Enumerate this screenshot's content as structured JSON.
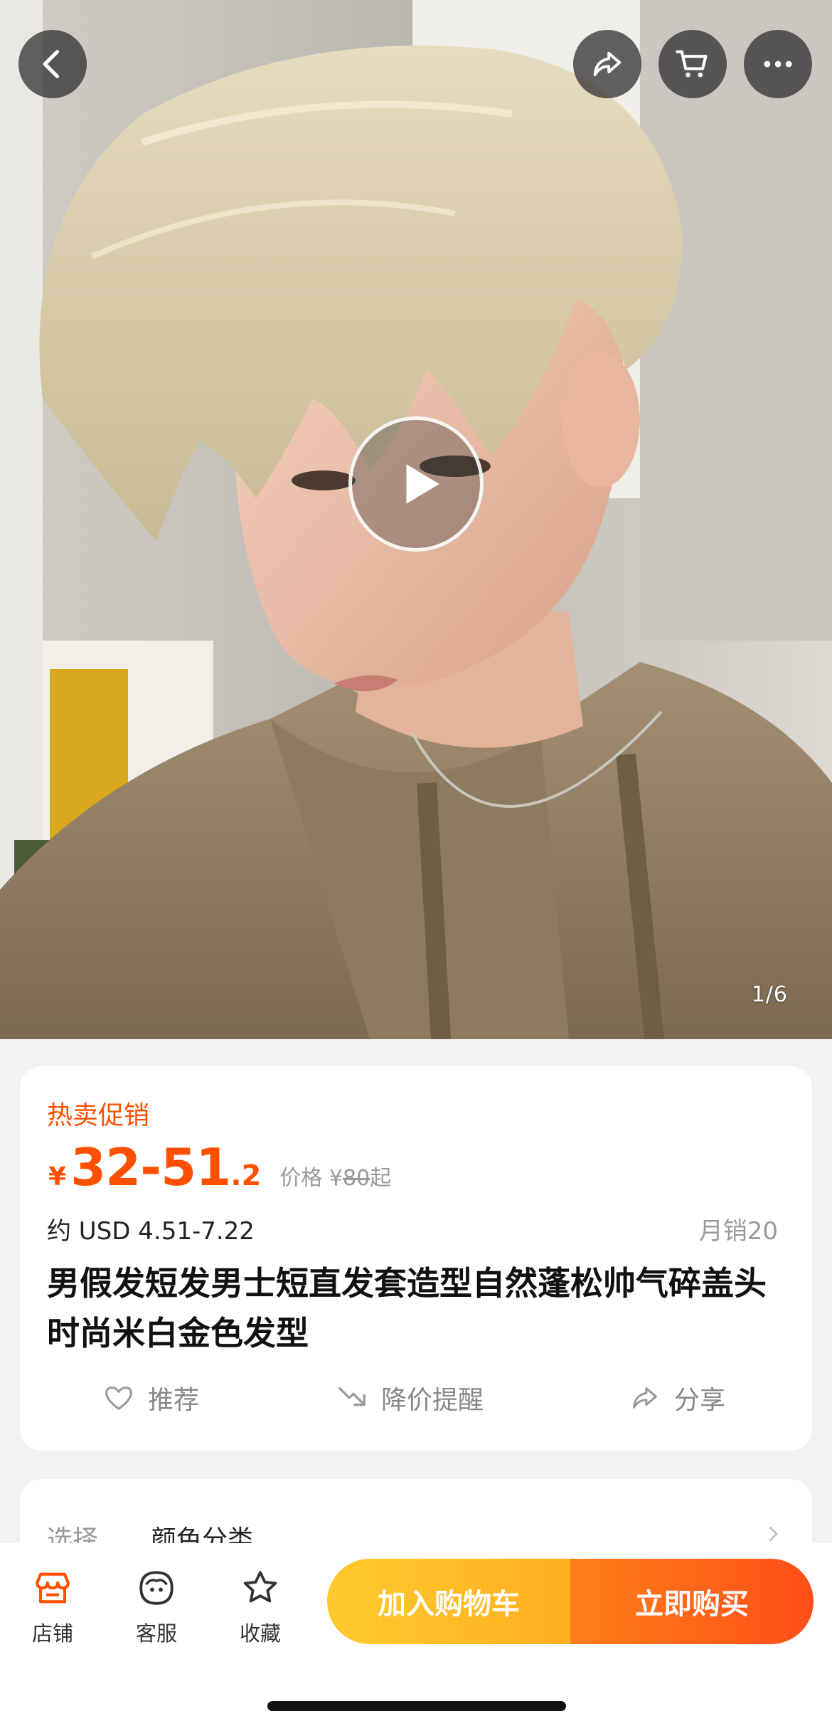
{
  "hero": {
    "page_indicator": "1/6",
    "image_subject": "product-photo-blonde-wig"
  },
  "top_nav": {
    "back_icon": "chevron-left-icon",
    "share_icon": "share-icon",
    "cart_icon": "cart-icon",
    "more_icon": "more-icon"
  },
  "price_card": {
    "promo_tag": "热卖促销",
    "currency": "¥",
    "price_main": "32-51",
    "price_decimal": ".2",
    "orig_price_label": "价格 ¥",
    "orig_price_value": "80",
    "orig_price_suffix": "起",
    "usd_price": "约 USD 4.51-7.22",
    "monthly_sales": "月销20",
    "title": "男假发短发男士短直发套造型自然蓬松帅气碎盖头时尚米白金色发型",
    "actions": [
      {
        "label": "推荐",
        "icon": "heart-icon"
      },
      {
        "label": "降价提醒",
        "icon": "price-drop-icon"
      },
      {
        "label": "分享",
        "icon": "share-icon"
      }
    ]
  },
  "option_card": {
    "label": "选择",
    "value": "颜色分类"
  },
  "bottom_bar": {
    "tabs": [
      {
        "label": "店铺",
        "icon": "shop-icon"
      },
      {
        "label": "客服",
        "icon": "customer-service-icon"
      },
      {
        "label": "收藏",
        "icon": "star-icon"
      }
    ],
    "add_to_cart": "加入购物车",
    "buy_now": "立即购买"
  },
  "colors": {
    "accent": "#ff5000",
    "cart_button": "#ffae21",
    "buy_button": "#ff4e17",
    "shop_tab_icon": "#ff5000"
  }
}
